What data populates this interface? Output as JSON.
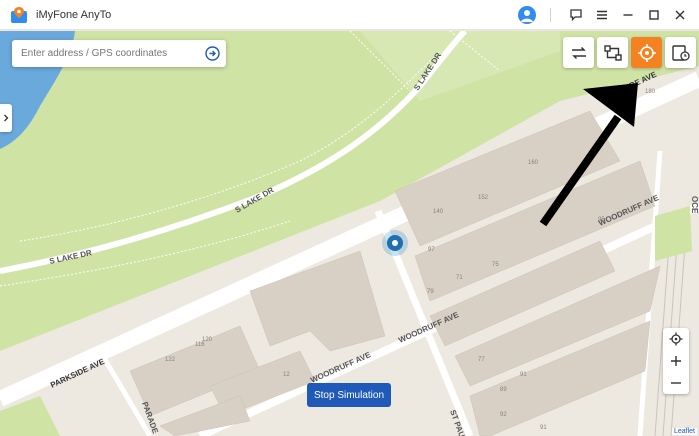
{
  "app": {
    "title": "iMyFone AnyTo"
  },
  "search": {
    "placeholder": "Enter address / GPS coordinates"
  },
  "map": {
    "streets": {
      "s_lake_dr_top": "S LAKE DR",
      "s_lake_dr_mid": "S LAKE DR",
      "s_lake_dr_low": "S LAKE DR",
      "parkside_ave_top": "PARKSIDE AVE",
      "parkside_ave_bottom": "PARKSIDE AVE",
      "woodruff_ave_top": "WOODRUFF AVE",
      "woodruff_ave_mid": "WOODRUFF AVE",
      "woodruff_ave_low": "WOODRUFF AVE",
      "st_paul": "ST PAU",
      "parade": "PARADE",
      "ocean": "OCE"
    },
    "house_numbers": [
      "180",
      "160",
      "152",
      "140",
      "97",
      "79",
      "95",
      "75",
      "71",
      "120",
      "116",
      "122",
      "12",
      "77",
      "89",
      "91",
      "92",
      "91"
    ]
  },
  "buttons": {
    "stop_simulation": "Stop Simulation"
  },
  "attribution": "Leaflet",
  "colors": {
    "accent": "#f58220",
    "primary": "#1f5ab8",
    "park": "#cfe3a5",
    "water": "#6aa9dc",
    "land": "#ede8e0"
  }
}
